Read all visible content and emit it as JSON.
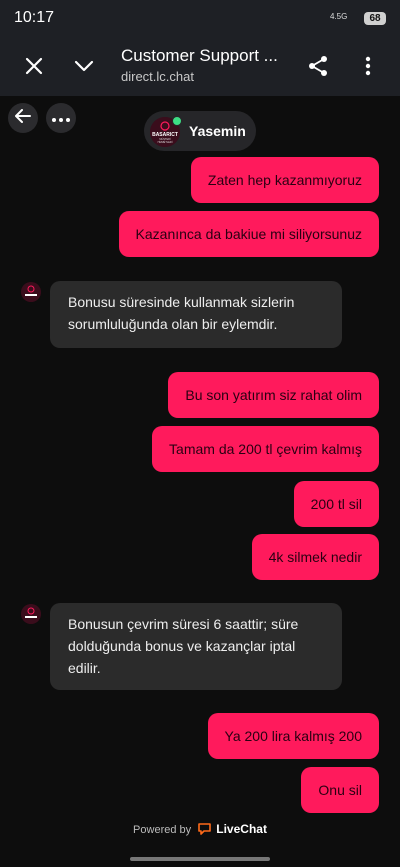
{
  "status": {
    "time": "10:17",
    "network": "4.5G",
    "battery": "68"
  },
  "browser": {
    "title": "Customer Support ...",
    "url": "direct.lc.chat"
  },
  "chat": {
    "agent_name": "Yasemin",
    "agent_logo_text": "BASARICT",
    "agent_logo_sub1": "MÜŞTERİ",
    "agent_logo_sub2": "HİZMETLERİ",
    "messages": [
      {
        "from": "user",
        "text": "Zaten hep kazanmıyoruz"
      },
      {
        "from": "user",
        "text": "Kazanınca da bakiue mi siliyorsunuz"
      },
      {
        "from": "agent",
        "text": "Bonusu süresinde kullanmak sizlerin sorumluluğunda olan bir eylemdir."
      },
      {
        "from": "user",
        "text": "Bu son yatırım siz rahat olim"
      },
      {
        "from": "user",
        "text": "Tamam da 200 tl çevrim kalmış"
      },
      {
        "from": "user",
        "text": "200 tl sil"
      },
      {
        "from": "user",
        "text": "4k silmek nedir"
      },
      {
        "from": "agent",
        "text": "Bonusun çevrim süresi 6 saattir; süre dolduğunda bonus ve kazançlar iptal edilir."
      },
      {
        "from": "user",
        "text": "Ya 200 lira kalmış 200"
      },
      {
        "from": "user",
        "text": "Onu sil"
      }
    ]
  },
  "footer": {
    "powered_by": "Powered by",
    "brand": "LiveChat"
  },
  "colors": {
    "accent": "#ff1a5c",
    "bubble_in": "#2b2b2b",
    "background": "#0d0d0d",
    "online": "#3ddc84"
  },
  "icons": [
    "close-icon",
    "chevron-down-icon",
    "share-icon",
    "more-vert-icon",
    "back-arrow-icon",
    "more-horiz-icon",
    "livechat-logo-icon"
  ]
}
